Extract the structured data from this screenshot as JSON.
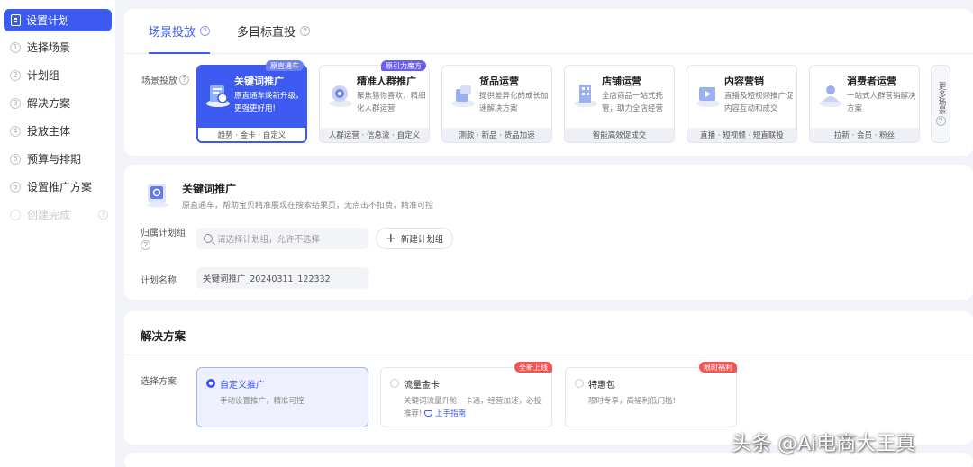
{
  "sidebar": {
    "active": {
      "label": "设置计划",
      "icon": "document-icon"
    },
    "items": [
      {
        "num": "1",
        "label": "选择场景"
      },
      {
        "num": "2",
        "label": "计划组"
      },
      {
        "num": "3",
        "label": "解决方案"
      },
      {
        "num": "4",
        "label": "投放主体"
      },
      {
        "num": "5",
        "label": "预算与排期"
      },
      {
        "num": "6",
        "label": "设置推广方案"
      },
      {
        "num": "",
        "label": "创建完成",
        "disabled": true
      }
    ]
  },
  "tabs": [
    {
      "label": "场景投放",
      "active": true
    },
    {
      "label": "多目标直投",
      "active": false
    }
  ],
  "scene_section": {
    "label": "场景投放",
    "more_label": "更多场景",
    "cards": [
      {
        "title": "关键词推广",
        "desc": "原直通车焕新升级，更强更好用!",
        "foot": "趋势 · 金卡 · 自定义",
        "badge": "原直通车",
        "icon": "keyword-promo-icon",
        "selected": true
      },
      {
        "title": "精准人群推广",
        "desc": "聚焦猜你喜欢，精细化人群运营",
        "foot": "人群运营 · 信息流 · 自定义",
        "badge": "原引力魔方",
        "icon": "audience-target-icon",
        "selected": false
      },
      {
        "title": "货品运营",
        "desc": "提供差异化的成长加速解决方案",
        "foot": "测款 · 新品 · 货品加速",
        "badge": "",
        "icon": "product-ops-icon",
        "selected": false
      },
      {
        "title": "店铺运营",
        "desc": "全店商品一站式托管，助力全店经营",
        "foot": "智能高效促成交",
        "badge": "",
        "icon": "store-ops-icon",
        "selected": false
      },
      {
        "title": "内容营销",
        "desc": "直播及短视频推广促内容互动和成交",
        "foot": "直播 · 短视频 · 短直联投",
        "badge": "",
        "icon": "content-marketing-icon",
        "selected": false
      },
      {
        "title": "消费者运营",
        "desc": "一站式人群营销解决方案",
        "foot": "拉新 · 会员 · 粉丝",
        "badge": "",
        "icon": "consumer-ops-icon",
        "selected": false
      }
    ]
  },
  "keyword_section": {
    "title": "关键词推广",
    "desc": "原直通车，帮助宝贝精准展现在搜索结果页，无点击不扣费，精准可控",
    "plan_group_label": "归属计划组",
    "plan_group_placeholder": "请选择计划组，允许不选择",
    "new_plan_group_label": "新建计划组",
    "plan_name_label": "计划名称",
    "plan_name_value": "关键词推广_20240311_122332"
  },
  "solution_section": {
    "title": "解决方案",
    "choose_label": "选择方案",
    "options": [
      {
        "title": "自定义推广",
        "desc": "手动设置推广，精准可控",
        "badge": "",
        "selected": true
      },
      {
        "title": "流量金卡",
        "desc": "关键词流量升舱一卡通，经营加速，必投推荐!",
        "guide": "上手指南",
        "badge": "全新上线",
        "selected": false
      },
      {
        "title": "特惠包",
        "desc": "限时专享，高福利低门槛!",
        "badge": "限时福利",
        "selected": false
      }
    ]
  },
  "watermark": "头条 @Ai电商大王真",
  "colors": {
    "accent": "#3d5af1",
    "badge_red": "#f35555",
    "badge_purple": "#6a5cf5"
  }
}
